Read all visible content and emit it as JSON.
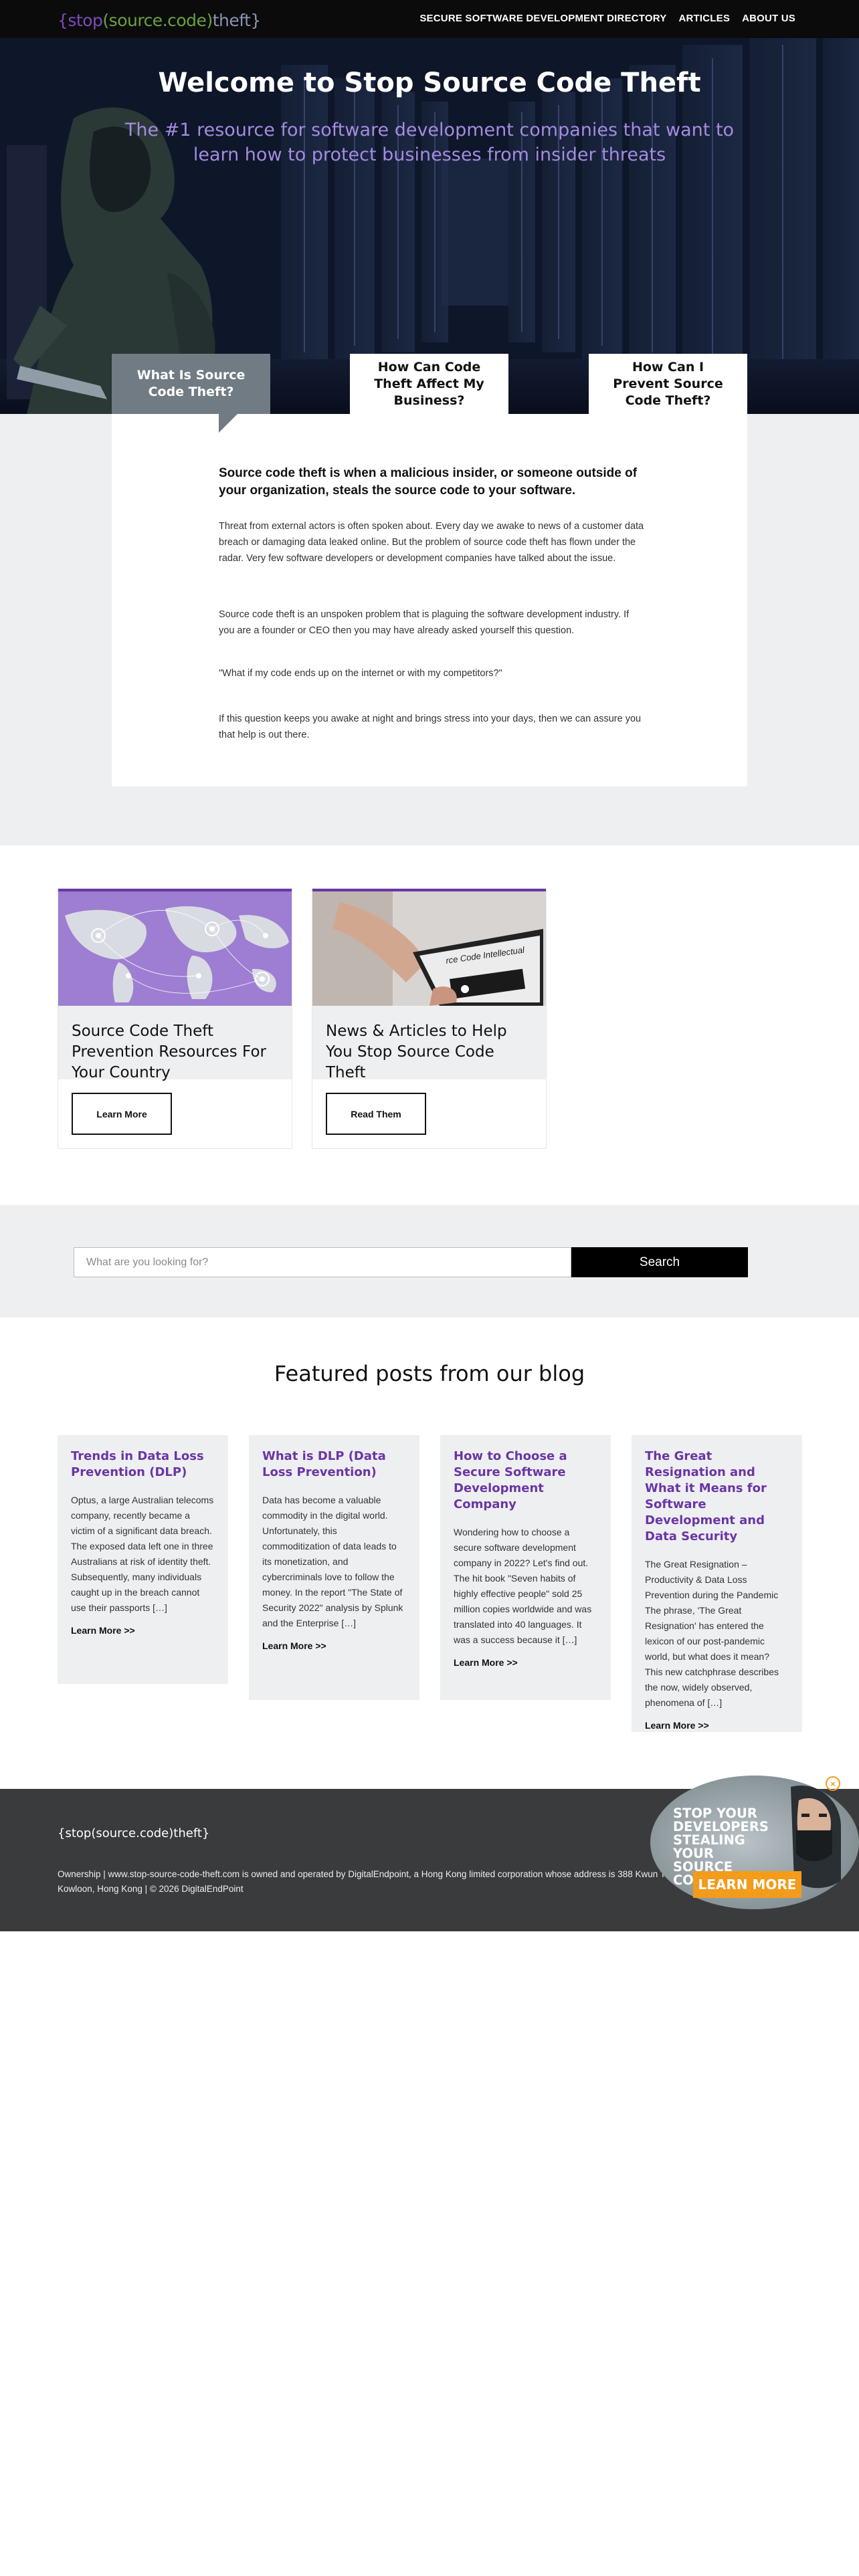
{
  "nav": {
    "logo": {
      "open": "{stop",
      "paren_open": "(",
      "middle": "source.code",
      "paren_close": ")",
      "end": "theft}"
    },
    "links": [
      "SECURE SOFTWARE DEVELOPMENT DIRECTORY",
      "ARTICLES",
      "ABOUT US"
    ]
  },
  "hero": {
    "title": "Welcome to Stop Source Code Theft",
    "subtitle": "The #1 resource for software development companies that want to learn how to protect businesses from insider threats"
  },
  "tabs": [
    {
      "label": "What Is Source Code Theft?",
      "active": true
    },
    {
      "label": "How Can Code Theft Affect My Business?",
      "active": false
    },
    {
      "label": "How Can I Prevent Source Code Theft?",
      "active": false
    }
  ],
  "panel": {
    "lead": "Source code theft is when a malicious insider, or someone outside of your organization, steals the source code to your software.",
    "paragraphs": [
      "Threat from external actors is often spoken about. Every day we awake to news of a customer data breach or damaging data leaked online. But the problem of source code theft has flown under the radar. Very few software developers or development companies have talked about the issue.",
      "Source code theft is an unspoken problem that is plaguing the software development industry. If you are a founder or CEO then you may have already asked yourself this question.",
      "\"What if my code ends up on the internet or with my competitors?\"",
      "If this question keeps you awake at night and brings stress into your days, then we can assure you that help is out there."
    ]
  },
  "cards": [
    {
      "title": "Source Code Theft Prevention Resources For Your Country",
      "button": "Learn More"
    },
    {
      "title": "News & Articles to Help You Stop Source Code Theft",
      "button": "Read Them",
      "image_text": "rce Code Intellectual"
    }
  ],
  "search": {
    "placeholder": "What are you looking for?",
    "button": "Search"
  },
  "blog": {
    "heading": "Featured posts from our blog",
    "posts": [
      {
        "title": "Trends in Data Loss Prevention (DLP)",
        "excerpt": "Optus, a large Australian telecoms company, recently became a victim of a significant data breach. The exposed data left one in three Australians at risk of identity theft. Subsequently, many individuals caught up in the breach cannot use their passports […]",
        "more": "Learn More >>"
      },
      {
        "title": "What is DLP (Data Loss Prevention)",
        "excerpt": "Data has become a valuable commodity in the digital world. Unfortunately, this commoditization of data leads to its monetization, and cybercriminals love to follow the money. In the report \"The State of Security 2022\" analysis by Splunk and the Enterprise […]",
        "more": "Learn More >>"
      },
      {
        "title": "How to Choose a Secure Software Development Company",
        "excerpt": "Wondering how to choose a secure software development company in 2022? Let's find out.  The hit book \"Seven habits of highly effective people\" sold 25 million copies worldwide and was translated into 40 languages. It was a success because it […]",
        "more": "Learn More >>"
      },
      {
        "title": "The Great Resignation and What it Means for Software Development and Data Security",
        "excerpt": "The Great Resignation – Productivity & Data Loss Prevention during the Pandemic The phrase, 'The Great Resignation' has entered the lexicon of our post-pandemic world, but what does it mean? This new catchphrase describes the now, widely observed, phenomena of […]",
        "more": "Learn More >>"
      }
    ]
  },
  "footer": {
    "logo": "{stop(source.code)theft}",
    "text": "Ownership | www.stop-source-code-theft.com is owned and operated by DigitalEndpoint, a Hong Kong limited corporation whose address is 388 Kwun Tong Road, Kowloon, Hong Kong | © 2026 DigitalEndPoint"
  },
  "promo": {
    "text": "Stop your developers stealing your source code",
    "button": "LEARN MORE",
    "close": "×"
  },
  "colors": {
    "accent_purple": "#6a35a5",
    "logo_green": "#6aa23e",
    "promo_orange": "#f39b1b",
    "footer_bg": "#3a3b3d"
  }
}
